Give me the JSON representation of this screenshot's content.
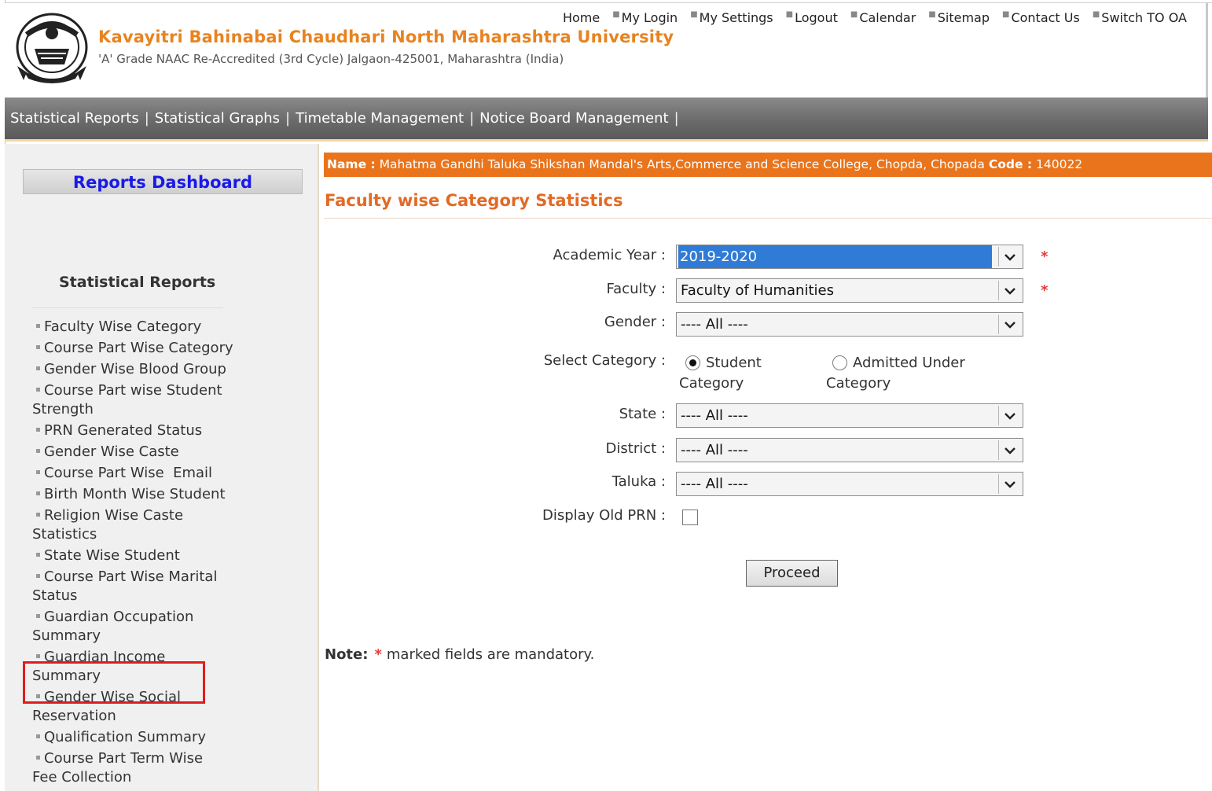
{
  "header": {
    "university_name": "Kavayitri Bahinabai Chaudhari North Maharashtra University",
    "subtitle": "'A' Grade NAAC Re-Accredited (3rd Cycle) Jalgaon-425001, Maharashtra (India)",
    "logo_icon": "university-seal-icon",
    "top_links": [
      "Home",
      "My Login",
      "My Settings",
      "Logout",
      "Calendar",
      "Sitemap",
      "Contact Us",
      "Switch TO OA"
    ]
  },
  "menu": {
    "items": [
      "Statistical Reports",
      "Statistical Graphs",
      "Timetable Management",
      "Notice Board Management"
    ],
    "separator": "|"
  },
  "sidebar": {
    "dashboard_label": "Reports Dashboard",
    "section_title": "Statistical Reports",
    "reports": [
      "Faculty Wise Category",
      "Course Part Wise Category",
      "Gender Wise Blood Group",
      "Course Part wise Student Strength",
      "PRN Generated Status",
      "Gender Wise Caste",
      "Course Part Wise  Email",
      "Birth Month Wise Student",
      "Religion Wise Caste Statistics",
      "State Wise Student",
      "Course Part Wise Marital Status",
      "Guardian Occupation Summary",
      "Guardian Income Summary",
      "Gender Wise Social Reservation",
      "Qualification Summary",
      "Course Part Term Wise Fee Collection"
    ]
  },
  "college": {
    "name_label": "Name :",
    "name": "Mahatma Gandhi Taluka Shikshan Mandal's Arts,Commerce and Science College, Chopda, Chopada",
    "code_label": "Code :",
    "code": "140022"
  },
  "form": {
    "title": "Faculty wise Category Statistics",
    "academic_year_label": "Academic Year :",
    "academic_year_value": "2019-2020",
    "faculty_label": "Faculty :",
    "faculty_value": "Faculty of Humanities",
    "gender_label": "Gender :",
    "gender_value": "---- All ----",
    "category_label": "Select Category :",
    "category_student": [
      "Student",
      "Category"
    ],
    "category_admitted": [
      "Admitted Under",
      "Category"
    ],
    "state_label": "State :",
    "state_value": "---- All ----",
    "district_label": "District :",
    "district_value": "---- All ----",
    "taluka_label": "Taluka :",
    "taluka_value": "---- All ----",
    "old_prn_label": "Display Old PRN :",
    "required_mark": "*",
    "proceed_label": "Proceed"
  },
  "note": {
    "label": "Note:",
    "star": "*",
    "text": "marked fields are mandatory."
  },
  "colors": {
    "accent_orange": "#e9741c",
    "title_orange": "#e26a25",
    "link_blue": "#1a1ae6",
    "highlight_red": "#e21c1c"
  }
}
